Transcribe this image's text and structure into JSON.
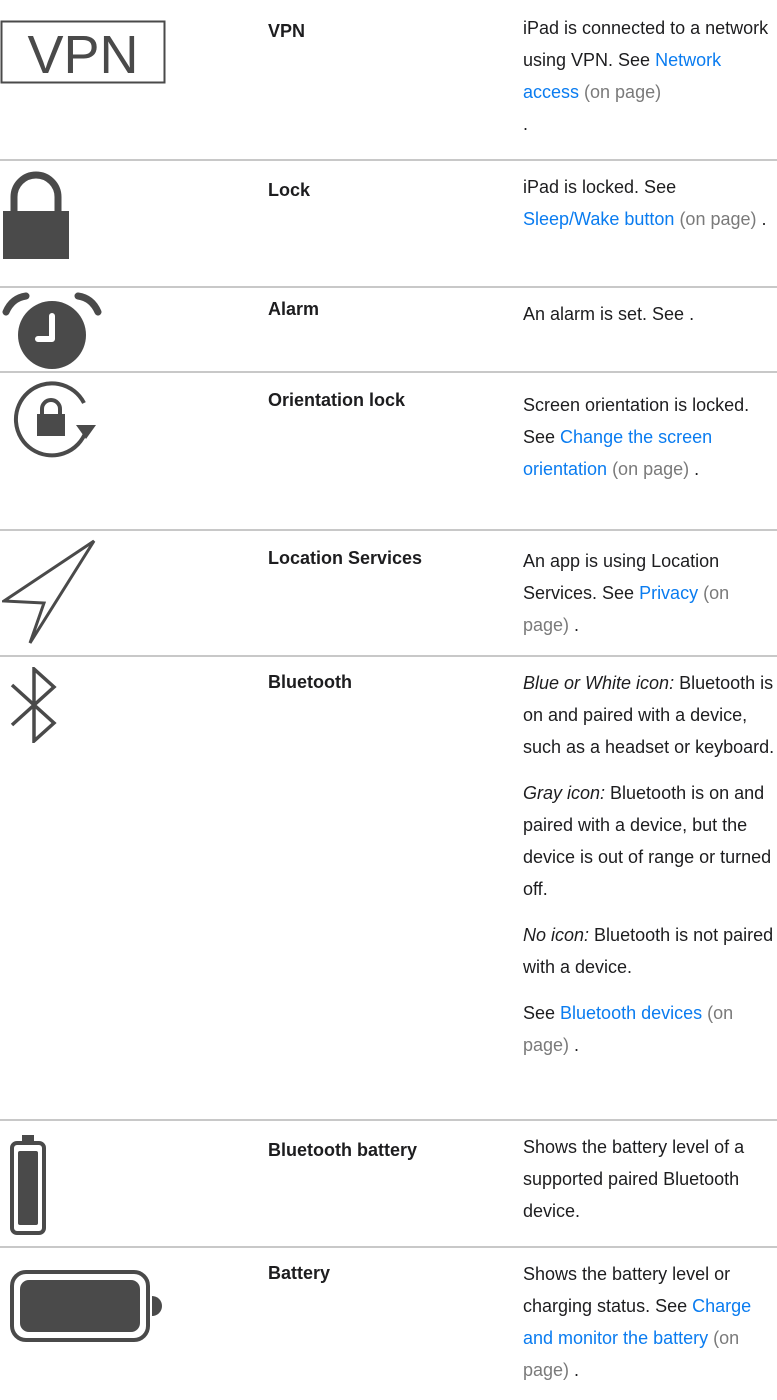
{
  "rows": [
    {
      "name": "VPN",
      "icon_label": "VPN",
      "d1": "iPad is connected to a network using VPN. See ",
      "link": "Network access",
      "ref": " (on page)",
      "end": "."
    },
    {
      "name": "Lock",
      "d1": "iPad is locked. See ",
      "link": "Sleep/Wake button",
      "ref": " (on page)",
      "end": " ."
    },
    {
      "name": "Alarm",
      "d1": "An alarm is set. See ."
    },
    {
      "name": "Orientation lock",
      "d1": "Screen orientation is locked. See ",
      "link": "Change the screen orientation",
      "ref": " (on page)",
      "end": " ."
    },
    {
      "name": "Location Services",
      "d1": "An app is using Location Services. See ",
      "link": "Privacy",
      "ref": " (on page)",
      "end": " ."
    },
    {
      "name": "Bluetooth",
      "p1_em": "Blue or White icon:",
      "p1": " Bluetooth is on and paired with a device, such as a headset or keyboard.",
      "p2_em": "Gray icon:",
      "p2": " Bluetooth is on and paired with a device, but the device is out of range or turned off.",
      "p3_em": "No icon:",
      "p3": " Bluetooth is not paired with a device.",
      "p4": "See ",
      "link": "Bluetooth devices",
      "ref": " (on page)",
      "end": " ."
    },
    {
      "name": "Bluetooth battery",
      "d1": "Shows the battery level of a supported paired Bluetooth device."
    },
    {
      "name": "Battery",
      "d1": "Shows the battery level or charging status. See ",
      "link": "Charge and monitor the battery",
      "ref": " (on page)",
      "end": " ."
    }
  ],
  "colors": {
    "link": "#0a7cf0",
    "muted": "#7a7a7a",
    "icon": "#4a4a4a",
    "separator": "#c8c8c8"
  },
  "icons": [
    "vpn-icon",
    "lock-icon",
    "alarm-icon",
    "orientation-lock-icon",
    "location-services-icon",
    "bluetooth-icon",
    "bluetooth-battery-icon",
    "battery-icon"
  ]
}
